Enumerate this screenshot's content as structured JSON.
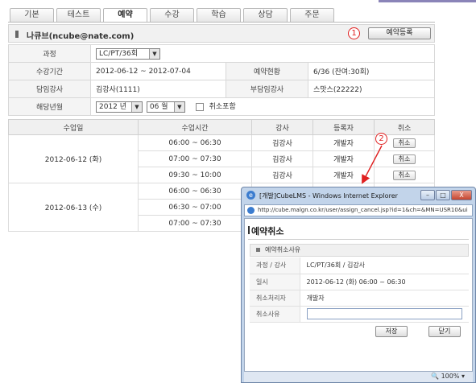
{
  "tabs": [
    "기본",
    "테스트",
    "예약",
    "수강",
    "학습",
    "상담",
    "주문"
  ],
  "user": {
    "name": "나큐브(ncube@nate.com)"
  },
  "markers": {
    "one": "1",
    "two": "2"
  },
  "reserve_button": "예약등록",
  "info": {
    "course_label": "과정",
    "course_value": "LC/PT/36회",
    "period_label": "수강기간",
    "period_value": "2012-06-12 ~ 2012-07-04",
    "status_label": "예약현황",
    "status_value": "6/36 (잔여:30회)",
    "teacher_label": "담임강사",
    "teacher_value": "김강사(1111)",
    "sub_teacher_label": "부담임강사",
    "sub_teacher_value": "스맛스(22222)",
    "month_label": "해당년월",
    "year_value": "2012 년",
    "month_value": "06 월",
    "include_cancel_label": "취소포함"
  },
  "schedule": {
    "headers": [
      "수업일",
      "수업시간",
      "강사",
      "등록자",
      "취소"
    ],
    "cancel_label": "취소",
    "days": [
      {
        "date": "2012-06-12 (화)",
        "rows": [
          {
            "time": "06:00 ~ 06:30",
            "teacher": "김강사",
            "registrant": "개발자"
          },
          {
            "time": "07:00 ~ 07:30",
            "teacher": "김강사",
            "registrant": "개발자"
          },
          {
            "time": "09:30 ~ 10:00",
            "teacher": "김강사",
            "registrant": "개발자"
          }
        ]
      },
      {
        "date": "2012-06-13 (수)",
        "rows": [
          {
            "time": "06:00 ~ 06:30"
          },
          {
            "time": "06:30 ~ 07:00"
          },
          {
            "time": "07:00 ~ 07:30"
          }
        ]
      }
    ]
  },
  "popup": {
    "window_title": "[개발]CubeLMS - Windows Internet Explorer",
    "url": "http://cube.malgn.co.kr/user/assign_cancel.jsp?id=1&ch=&MN=USR10&ui",
    "title": "예약취소",
    "section": "예약취소사유",
    "rows": [
      {
        "label": "과정 / 강사",
        "value": "LC/PT/36회 / 김강사"
      },
      {
        "label": "일시",
        "value": "2012-06-12 (화) 06:00 ~ 06:30"
      },
      {
        "label": "취소처리자",
        "value": "개발자"
      }
    ],
    "reason_label": "취소사유",
    "reason_value": "",
    "save_button": "저장",
    "close_button": "닫기",
    "zoom": "100%",
    "win_min": "–",
    "win_max": "□",
    "win_close": "X"
  },
  "colors": {
    "marker": "#e02020",
    "accent": "#8a84b8"
  }
}
